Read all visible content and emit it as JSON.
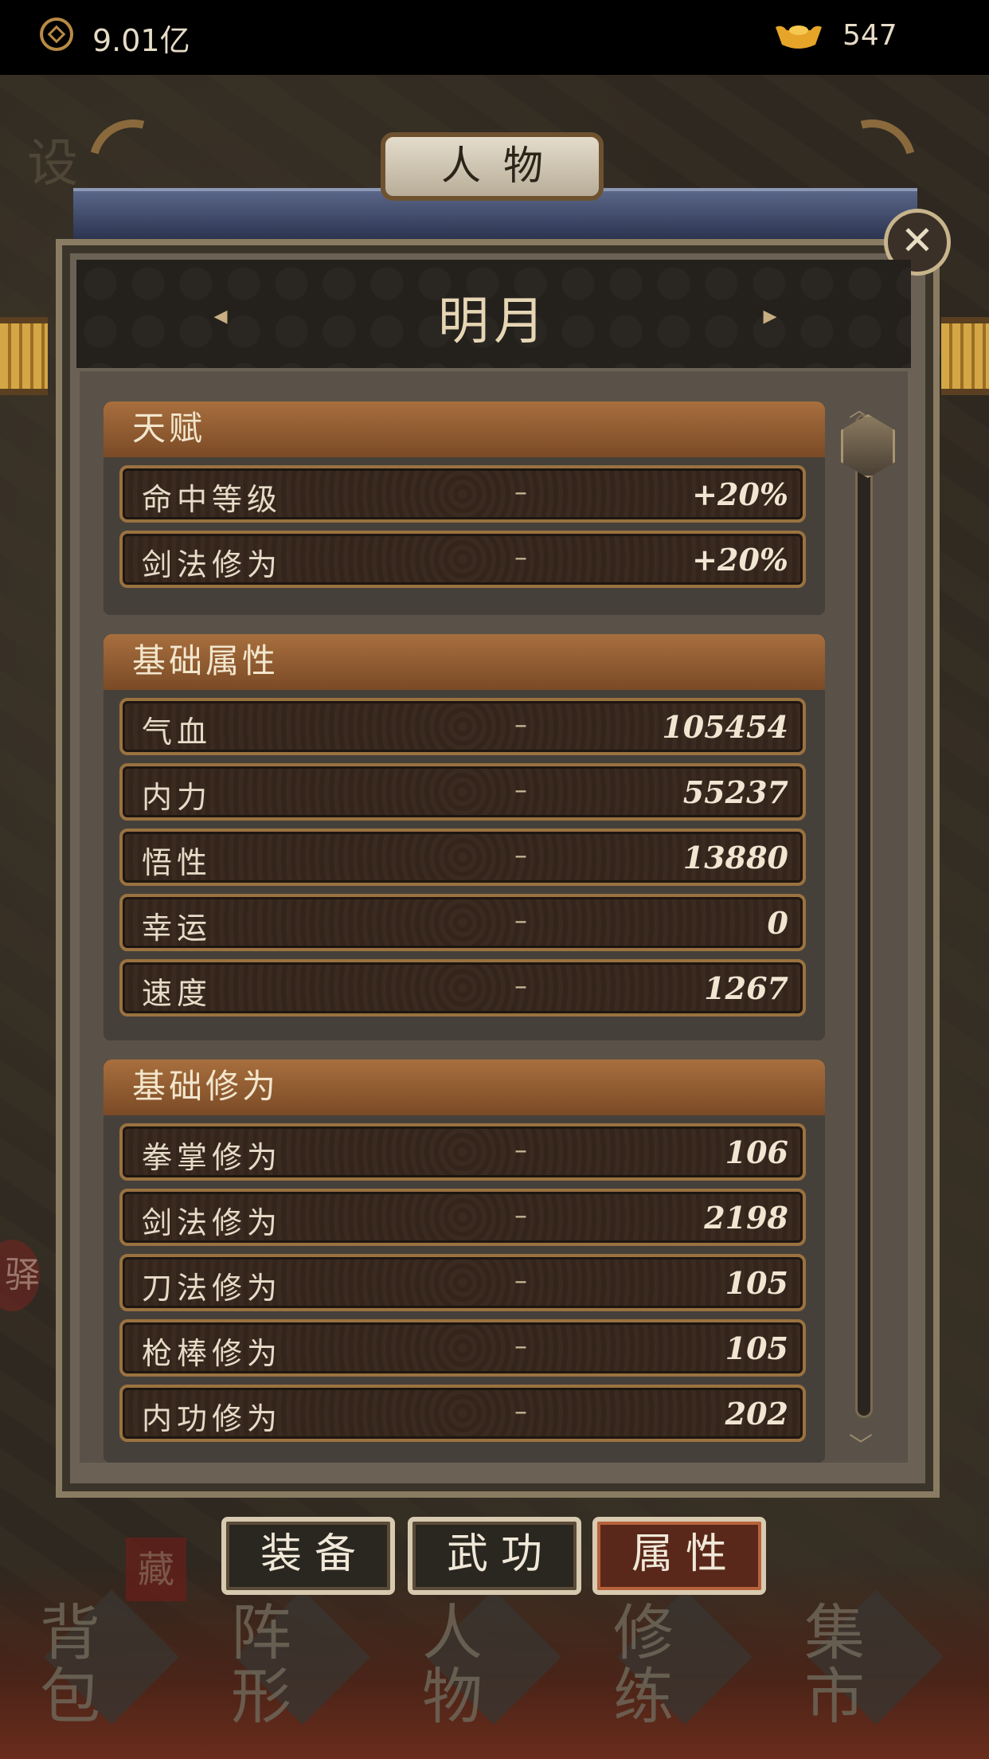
{
  "top_bar": {
    "coin_value": "9.01亿",
    "ingot_value": "547"
  },
  "panel": {
    "title": "人物",
    "character_name": "明月",
    "close_glyph": "✕",
    "prev_glyph": "◂",
    "next_glyph": "▸"
  },
  "sections": [
    {
      "title": "天赋",
      "rows": [
        {
          "label": "命中等级",
          "dash": "–",
          "value": "+20%"
        },
        {
          "label": "剑法修为",
          "dash": "–",
          "value": "+20%"
        }
      ]
    },
    {
      "title": "基础属性",
      "rows": [
        {
          "label": "气血",
          "dash": "–",
          "value": "105454"
        },
        {
          "label": "内力",
          "dash": "–",
          "value": "55237"
        },
        {
          "label": "悟性",
          "dash": "–",
          "value": "13880"
        },
        {
          "label": "幸运",
          "dash": "–",
          "value": "0"
        },
        {
          "label": "速度",
          "dash": "–",
          "value": "1267"
        }
      ]
    },
    {
      "title": "基础修为",
      "rows": [
        {
          "label": "拳掌修为",
          "dash": "–",
          "value": "106"
        },
        {
          "label": "剑法修为",
          "dash": "–",
          "value": "2198"
        },
        {
          "label": "刀法修为",
          "dash": "–",
          "value": "105"
        },
        {
          "label": "枪棒修为",
          "dash": "–",
          "value": "105"
        },
        {
          "label": "内功修为",
          "dash": "–",
          "value": "202"
        }
      ]
    }
  ],
  "tabs": [
    {
      "label": "装备",
      "active": false
    },
    {
      "label": "武功",
      "active": false
    },
    {
      "label": "属性",
      "active": true
    }
  ],
  "bottom_nav": [
    {
      "label": "背包"
    },
    {
      "label": "阵形"
    },
    {
      "label": "人物"
    },
    {
      "label": "修练"
    },
    {
      "label": "集市"
    }
  ],
  "background": {
    "top_left_mark": "设",
    "stamp": "藏",
    "side_seal": "驿"
  },
  "colors": {
    "section_header": "#a86f3e",
    "row_border": "#9a7240",
    "active_tab": "#5a281a",
    "currency": "#b88a45"
  },
  "icons": {
    "coin": "coin-icon",
    "ingot": "gold-ingot-icon",
    "close": "close-icon",
    "prev": "arrow-left-icon",
    "next": "arrow-right-icon"
  }
}
